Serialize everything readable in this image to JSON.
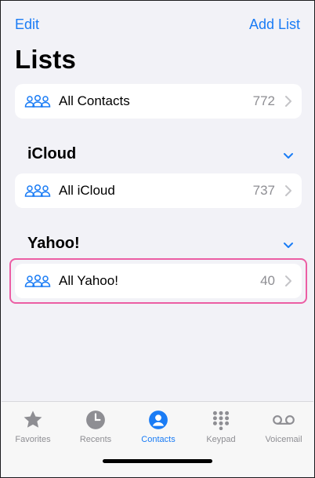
{
  "nav": {
    "edit_label": "Edit",
    "add_list_label": "Add List"
  },
  "page_title": "Lists",
  "all_contacts": {
    "label": "All Contacts",
    "count": "772"
  },
  "sections": [
    {
      "title": "iCloud",
      "row": {
        "label": "All iCloud",
        "count": "737"
      }
    },
    {
      "title": "Yahoo!",
      "row": {
        "label": "All Yahoo!",
        "count": "40"
      }
    }
  ],
  "tabs": [
    {
      "label": "Favorites",
      "icon": "star-icon"
    },
    {
      "label": "Recents",
      "icon": "clock-icon"
    },
    {
      "label": "Contacts",
      "icon": "person-circle-icon",
      "active": true
    },
    {
      "label": "Keypad",
      "icon": "keypad-icon"
    },
    {
      "label": "Voicemail",
      "icon": "voicemail-icon"
    }
  ],
  "colors": {
    "accent": "#1a7cf5",
    "highlight": "#ec5ea4",
    "muted": "#8e8e93"
  }
}
